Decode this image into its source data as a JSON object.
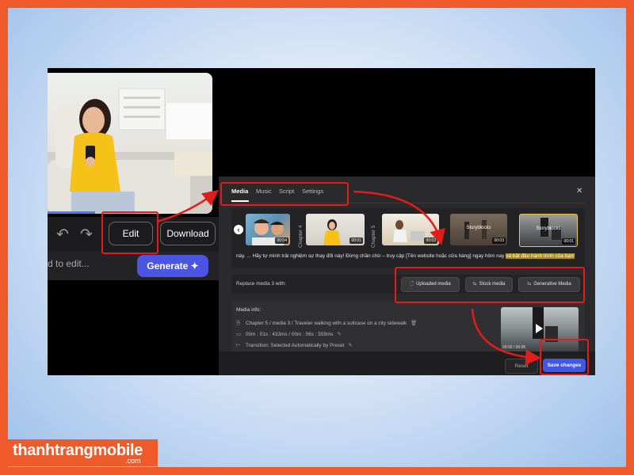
{
  "left_panel": {
    "undo_icon": "undo-icon",
    "redo_icon": "redo-icon",
    "edit_label": "Edit",
    "download_label": "Download",
    "prompt_placeholder": "d to edit...",
    "generate_label": "Generate",
    "generate_icon": "sparkle-icon"
  },
  "editor": {
    "tabs": [
      {
        "label": "Media",
        "active": true
      },
      {
        "label": "Music",
        "active": false
      },
      {
        "label": "Script",
        "active": false
      },
      {
        "label": "Settings",
        "active": false
      }
    ],
    "close_icon": "close-icon",
    "media_strip": {
      "nav_arrow_icon": "chevron-left-icon",
      "thumbs": [
        {
          "duration": "00:04",
          "caption": ""
        },
        {
          "duration": "00:01",
          "caption": ""
        },
        {
          "duration": "00:03",
          "caption": ""
        },
        {
          "duration": "00:03",
          "caption": "Storyblocks"
        },
        {
          "duration": "00:01",
          "caption": "Storyblocks"
        }
      ],
      "chapters": [
        "Chapter 4",
        "Chapter 5"
      ],
      "script_text": "này. ... Hãy tự mình trải nghiệm sự thay đổi này! Đừng chần chừ – truy cập [Tên website hoặc cửa hàng] ngay hôm nay ",
      "script_highlight": "và bắt đầu hành trình của bạn!"
    },
    "replace": {
      "label": "Replace media 3 with:",
      "options": [
        {
          "label": "Uploaded media",
          "icon": "file-icon"
        },
        {
          "label": "Stock media",
          "icon": "swap-icon"
        },
        {
          "label": "Generative Media",
          "icon": "swap-icon"
        }
      ]
    },
    "info": {
      "title": "Media info:",
      "rows": [
        {
          "icon": "document-icon",
          "text": "Chapter 5 / media 3 / Traveler walking with a suitcase on a city sidewalk"
        },
        {
          "icon": "clock-icon",
          "text": "00m : 01s : 433ms / 00m : 06s : 559ms"
        },
        {
          "icon": "transition-icon",
          "text": "Transition: Selected Automatically by Preset"
        }
      ],
      "thumb_time": "00:00 / 00:06"
    },
    "reset_label": "Reset",
    "save_label": "Save changes"
  },
  "branding": {
    "logo_text": "thanhtrangmobile",
    "logo_sub": ".com"
  },
  "colors": {
    "accent": "#4057e8",
    "annotation": "#e21b1b",
    "frame": "#ef5a2a"
  }
}
